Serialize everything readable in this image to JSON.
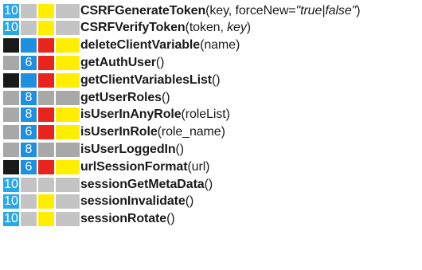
{
  "colors": {
    "black": "#1a1a1a",
    "blue": "#1f8fe0",
    "red": "#e8241c",
    "yellow": "#ffee00",
    "gray": "#a8a8a8",
    "light_gray": "#c4c4c4",
    "cyan": "#29a8e8"
  },
  "functions": [
    {
      "name": "CSRFGenerateToken",
      "open": "(",
      "args": "key, forceNew=",
      "italic_args": "\"true|false\"",
      "close": ")",
      "badges": [
        {
          "text": "10",
          "color": "#29a8e8"
        },
        {
          "text": "",
          "color": "#c4c4c4"
        },
        {
          "text": "",
          "color": "#ffee00"
        },
        {
          "text": "",
          "color": "#c4c4c4"
        }
      ]
    },
    {
      "name": "CSRFVerifyToken",
      "open": "(",
      "args": "token, ",
      "italic_args": "key",
      "close": ")",
      "badges": [
        {
          "text": "10",
          "color": "#29a8e8"
        },
        {
          "text": "",
          "color": "#c4c4c4"
        },
        {
          "text": "",
          "color": "#ffee00"
        },
        {
          "text": "",
          "color": "#c4c4c4"
        }
      ]
    },
    {
      "name": "deleteClientVariable",
      "open": "(",
      "args": "name",
      "italic_args": "",
      "close": ")",
      "badges": [
        {
          "text": "",
          "color": "#1a1a1a"
        },
        {
          "text": "",
          "color": "#1f8fe0"
        },
        {
          "text": "",
          "color": "#e8241c"
        },
        {
          "text": "",
          "color": "#ffee00"
        }
      ]
    },
    {
      "name": "getAuthUser",
      "open": "(",
      "args": "",
      "italic_args": "",
      "close": ")",
      "badges": [
        {
          "text": "",
          "color": "#a8a8a8"
        },
        {
          "text": "6",
          "color": "#1f8fe0"
        },
        {
          "text": "",
          "color": "#e8241c"
        },
        {
          "text": "",
          "color": "#ffee00"
        }
      ]
    },
    {
      "name": "getClientVariablesList",
      "open": "(",
      "args": "",
      "italic_args": "",
      "close": ")",
      "badges": [
        {
          "text": "",
          "color": "#1a1a1a"
        },
        {
          "text": "",
          "color": "#1f8fe0"
        },
        {
          "text": "",
          "color": "#e8241c"
        },
        {
          "text": "",
          "color": "#ffee00"
        }
      ]
    },
    {
      "name": "getUserRoles",
      "open": "(",
      "args": "",
      "italic_args": "",
      "close": ")",
      "badges": [
        {
          "text": "",
          "color": "#a8a8a8"
        },
        {
          "text": "8",
          "color": "#1f8fe0"
        },
        {
          "text": "",
          "color": "#a8a8a8"
        },
        {
          "text": "",
          "color": "#a8a8a8"
        }
      ]
    },
    {
      "name": "isUserInAnyRole",
      "open": "(",
      "args": "roleList",
      "italic_args": "",
      "close": ")",
      "badges": [
        {
          "text": "",
          "color": "#a8a8a8"
        },
        {
          "text": "8",
          "color": "#1f8fe0"
        },
        {
          "text": "",
          "color": "#e8241c"
        },
        {
          "text": "",
          "color": "#ffee00"
        }
      ]
    },
    {
      "name": "isUserInRole",
      "open": "(",
      "args": "role_name",
      "italic_args": "",
      "close": ")",
      "badges": [
        {
          "text": "",
          "color": "#a8a8a8"
        },
        {
          "text": "6",
          "color": "#1f8fe0"
        },
        {
          "text": "",
          "color": "#e8241c"
        },
        {
          "text": "",
          "color": "#ffee00"
        }
      ]
    },
    {
      "name": "isUserLoggedIn",
      "open": "(",
      "args": "",
      "italic_args": "",
      "close": ")",
      "badges": [
        {
          "text": "",
          "color": "#a8a8a8"
        },
        {
          "text": "8",
          "color": "#1f8fe0"
        },
        {
          "text": "",
          "color": "#a8a8a8"
        },
        {
          "text": "",
          "color": "#a8a8a8"
        }
      ]
    },
    {
      "name": "urlSessionFormat",
      "open": "(",
      "args": "url",
      "italic_args": "",
      "close": ")",
      "badges": [
        {
          "text": "",
          "color": "#1a1a1a"
        },
        {
          "text": "6",
          "color": "#1f8fe0"
        },
        {
          "text": "",
          "color": "#e8241c"
        },
        {
          "text": "",
          "color": "#ffee00"
        }
      ]
    },
    {
      "name": "sessionGetMetaData",
      "open": "(",
      "args": "",
      "italic_args": "",
      "close": ")",
      "badges": [
        {
          "text": "10",
          "color": "#29a8e8"
        },
        {
          "text": "",
          "color": "#c4c4c4"
        },
        {
          "text": "",
          "color": "#c4c4c4"
        },
        {
          "text": "",
          "color": "#c4c4c4"
        }
      ]
    },
    {
      "name": "sessionInvalidate",
      "open": "(",
      "args": "",
      "italic_args": "",
      "close": ")",
      "badges": [
        {
          "text": "10",
          "color": "#29a8e8"
        },
        {
          "text": "",
          "color": "#c4c4c4"
        },
        {
          "text": "",
          "color": "#ffee00"
        },
        {
          "text": "",
          "color": "#c4c4c4"
        }
      ]
    },
    {
      "name": "sessionRotate",
      "open": "(",
      "args": "",
      "italic_args": "",
      "close": ")",
      "badges": [
        {
          "text": "10",
          "color": "#29a8e8"
        },
        {
          "text": "",
          "color": "#c4c4c4"
        },
        {
          "text": "",
          "color": "#ffee00"
        },
        {
          "text": "",
          "color": "#c4c4c4"
        }
      ]
    }
  ]
}
